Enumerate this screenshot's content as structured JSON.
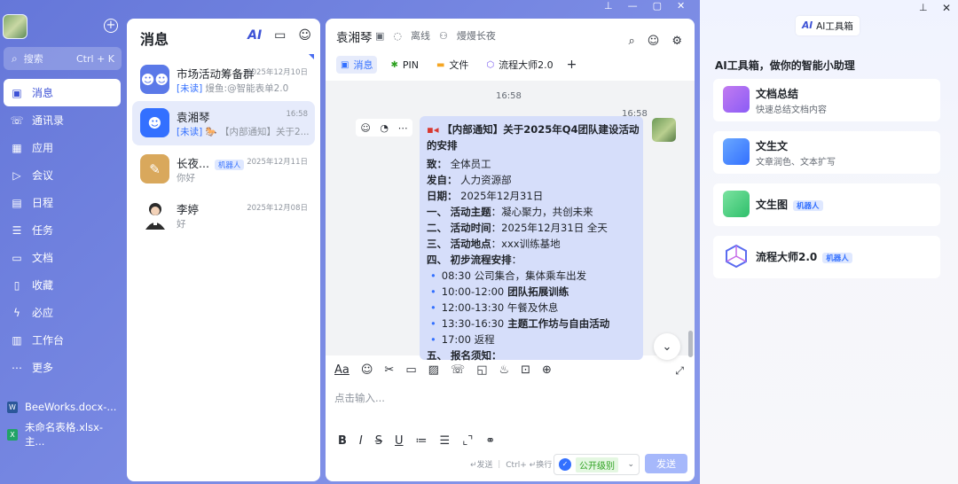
{
  "sidebar": {
    "search_placeholder": "搜索",
    "search_shortcut": "Ctrl + K",
    "nav": [
      {
        "label": "消息",
        "icon": "message-icon",
        "glyph": "▣"
      },
      {
        "label": "通讯录",
        "icon": "contacts-icon",
        "glyph": "☏"
      },
      {
        "label": "应用",
        "icon": "apps-icon",
        "glyph": "▦"
      },
      {
        "label": "会议",
        "icon": "meeting-icon",
        "glyph": "▷"
      },
      {
        "label": "日程",
        "icon": "calendar-icon",
        "glyph": "▤"
      },
      {
        "label": "任务",
        "icon": "task-icon",
        "glyph": "☰"
      },
      {
        "label": "文档",
        "icon": "document-icon",
        "glyph": "▭"
      },
      {
        "label": "收藏",
        "icon": "favorite-icon",
        "glyph": "▯"
      },
      {
        "label": "必应",
        "icon": "lightning-icon",
        "glyph": "ϟ"
      },
      {
        "label": "工作台",
        "icon": "workbench-icon",
        "glyph": "▥"
      },
      {
        "label": "更多",
        "icon": "more-icon",
        "glyph": "⋯"
      }
    ],
    "recent_files": [
      {
        "label": "BeeWorks.docx-...",
        "icon": "word-icon",
        "color": "#2b579a",
        "glyph": "W"
      },
      {
        "label": "未命名表格.xlsx-主...",
        "icon": "excel-icon",
        "color": "#21a366",
        "glyph": "X"
      }
    ]
  },
  "message_list": {
    "title": "消息",
    "conversations": [
      {
        "name": "市场活动筹备群",
        "time": "2025年12月10日",
        "unread": "[未读]",
        "preview": " 熳鱼:@智能表单2.0",
        "avatar_color": "#5b79e8",
        "avatar_glyph": "☻☻"
      },
      {
        "name": "袁湘琴",
        "time": "16:58",
        "unread": "[未读]",
        "preview": " 🐎 【内部通知】关于2...",
        "avatar_color": "#3370ff",
        "avatar_glyph": "☻"
      },
      {
        "name": "长夜...",
        "tag": "机器人",
        "time": "2025年12月11日",
        "unread": "",
        "preview": "你好",
        "avatar_color": "#d9a85c",
        "avatar_glyph": "✎"
      },
      {
        "name": "李婷",
        "time": "2025年12月08日",
        "unread": "",
        "preview": "好",
        "avatar_color": "#ffffff",
        "avatar_glyph": ""
      }
    ]
  },
  "chat": {
    "name": "袁湘琴",
    "status": "离线",
    "nickname": "熳熳长夜",
    "tabs": [
      {
        "label": "消息",
        "icon": "message-tab-icon",
        "glyph": "▣"
      },
      {
        "label": "PIN",
        "icon": "pin-tab-icon",
        "glyph": "✱"
      },
      {
        "label": "文件",
        "icon": "folder-tab-icon",
        "glyph": "▬"
      },
      {
        "label": "流程大师2.0",
        "icon": "workflow-tab-icon",
        "glyph": "⬡"
      }
    ],
    "time_center": "16:58",
    "time_right": "16:58",
    "message": {
      "title1": "【内部通知】关于2025年Q4团队建设活动",
      "title2": "的安排",
      "to_label": "致：",
      "to_value": "全体员工",
      "from_label": "发自：",
      "from_value": "人力资源部",
      "date_label": "日期：",
      "date_value": "2025年12月31日",
      "items": [
        {
          "num": "一、",
          "label": "活动主题",
          "value": "：凝心聚力，共创未来"
        },
        {
          "num": "二、",
          "label": "活动时间",
          "value": "：2025年12月31日 全天"
        },
        {
          "num": "三、",
          "label": "活动地点",
          "value": "：xxx训练基地"
        },
        {
          "num": "四、",
          "label": "初步流程安排",
          "value": "："
        }
      ],
      "schedule": [
        {
          "time": "08:30",
          "text": " 公司集合，集体乘车出发",
          "bold": false
        },
        {
          "time": "10:00-12:00",
          "text": " 团队拓展训练",
          "bold": true
        },
        {
          "time": "12:00-13:30",
          "text": " 午餐及休息",
          "bold": false
        },
        {
          "time": "13:30-16:30",
          "text": " 主题工作坊与自由活动",
          "bold": true
        },
        {
          "time": "17:00",
          "text": " 返程",
          "bold": false
        }
      ],
      "cut_line": "五、 报名须知："
    },
    "input_placeholder": "点击输入...",
    "send_hint": "↵发送 ｜ Ctrl+ ↵换行",
    "security_level": "公开级别",
    "send_label": "发送"
  },
  "ai_toolbox": {
    "header": "AI工具箱",
    "subtitle": "AI工具箱，做你的智能小助理",
    "tools": [
      {
        "title": "文档总结",
        "desc": "快速总结文档内容",
        "tag": "",
        "icon": "doc-summary-icon",
        "color1": "#c27bf0",
        "color2": "#8b5cf6"
      },
      {
        "title": "文生文",
        "desc": "文章润色、文本扩写",
        "tag": "",
        "icon": "text-generate-icon",
        "color1": "#6aa8ff",
        "color2": "#3370ff"
      },
      {
        "title": "文生图",
        "desc": "",
        "tag": "机器人",
        "icon": "image-generate-icon",
        "color1": "#7be3a0",
        "color2": "#2fbf6b"
      },
      {
        "title": "流程大师2.0",
        "desc": "",
        "tag": "机器人",
        "icon": "workflow-master-icon",
        "color1": "#ffffff",
        "color2": "#ffffff"
      }
    ]
  },
  "colors": {
    "accent": "#3370ff",
    "sidebar_bg": "#6f80de"
  }
}
